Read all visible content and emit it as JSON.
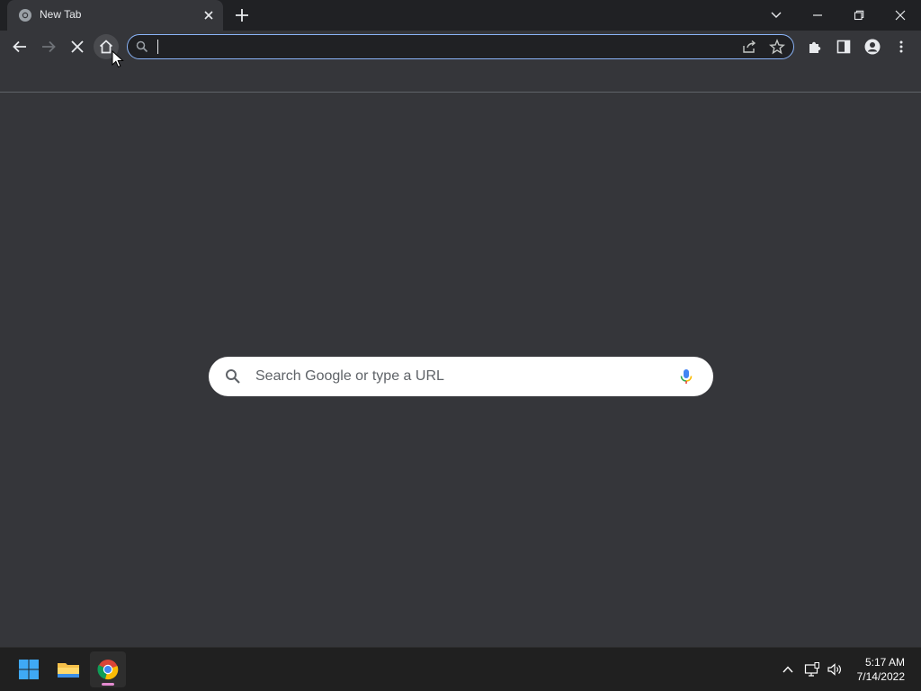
{
  "browser": {
    "tab": {
      "title": "New Tab"
    },
    "omnibox": {
      "value": "",
      "placeholder": ""
    },
    "ntp": {
      "search_placeholder": "Search Google or type a URL"
    }
  },
  "icons": {
    "tab_favicon": "new-tab-icon",
    "tab_close": "close-icon",
    "new_tab": "plus-icon",
    "tab_search": "chevron-down-icon",
    "minimize": "minimize-icon",
    "restore": "restore-icon",
    "close_window": "close-icon",
    "back": "arrow-left-icon",
    "forward": "arrow-right-icon",
    "stop": "stop-icon",
    "home": "home-icon",
    "share": "share-icon",
    "bookmark": "star-icon",
    "extensions": "puzzle-icon",
    "side_panel": "side-panel-icon",
    "profile": "profile-icon",
    "menu": "kebab-menu-icon",
    "mic": "microphone-icon"
  },
  "taskbar": {
    "apps": [
      "start",
      "file-explorer",
      "chrome"
    ],
    "clock": {
      "time": "5:17 AM",
      "date": "7/14/2022"
    }
  },
  "colors": {
    "accent": "#8ab4f8",
    "frame": "#202124",
    "toolbar": "#35363a",
    "taskbar": "#202020",
    "active_app_indicator": "#e38bd0"
  }
}
